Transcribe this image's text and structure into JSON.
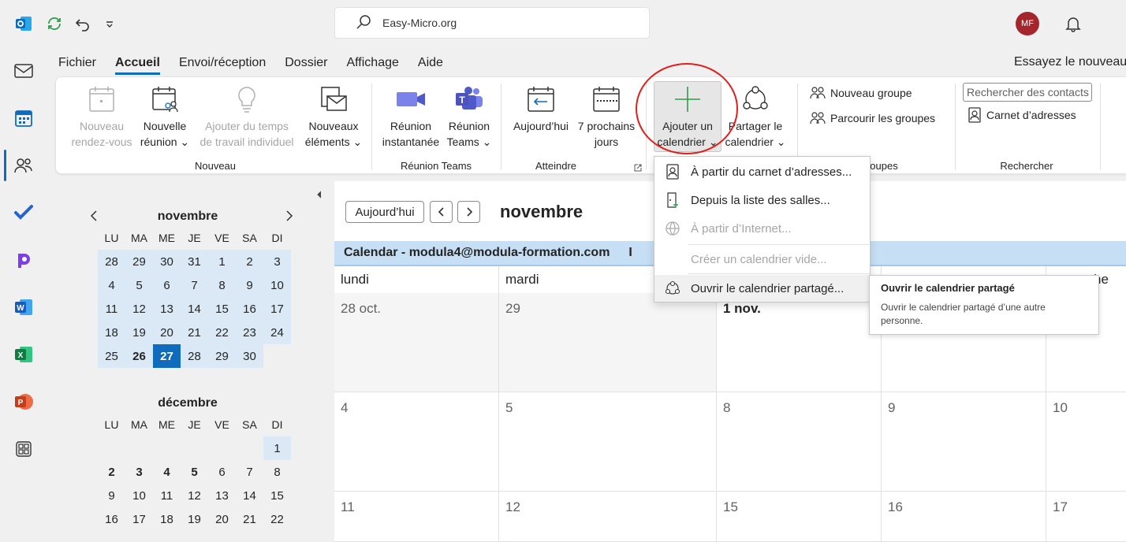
{
  "titlebar": {
    "search_text": "Easy-Micro.org",
    "avatar_initials": "MF"
  },
  "menu": {
    "items": [
      "Fichier",
      "Accueil",
      "Envoi/réception",
      "Dossier",
      "Affichage",
      "Aide"
    ],
    "selected": "Accueil",
    "try_new": "Essayez le nouveau"
  },
  "ribbon": {
    "nouveau_rdv": [
      "Nouveau",
      "rendez-vous"
    ],
    "nouvelle_reunion": [
      "Nouvelle",
      "réunion ⌄"
    ],
    "ajouter_temps": [
      "Ajouter du temps",
      "de travail individuel"
    ],
    "nouveaux_elements": [
      "Nouveaux",
      "éléments ⌄"
    ],
    "group_nouveau": "Nouveau",
    "reunion_instantanee": [
      "Réunion",
      "instantanée"
    ],
    "reunion_teams": [
      "Réunion",
      "Teams ⌄"
    ],
    "group_teams": "Réunion Teams",
    "aujourdhui": "Aujourd’hui",
    "sept_jours": [
      "7 prochains",
      "jours"
    ],
    "group_atteindre": "Atteindre",
    "ajouter_calendrier": [
      "Ajouter un",
      "calendrier ⌄"
    ],
    "partager": [
      "Partager le",
      "calendrier ⌄"
    ],
    "nouveau_groupe": "Nouveau groupe",
    "parcourir_groupes": "Parcourir les groupes",
    "group_groupes": "oupes",
    "rechercher_placeholder": "Rechercher des contacts",
    "carnet": "Carnet d’adresses",
    "group_rechercher": "Rechercher"
  },
  "mini_calendars": [
    {
      "title": "novembre",
      "dow": [
        "LU",
        "MA",
        "ME",
        "JE",
        "VE",
        "SA",
        "DI"
      ],
      "weeks": [
        [
          "28",
          "29",
          "30",
          "31",
          "1",
          "2",
          "3"
        ],
        [
          "4",
          "5",
          "6",
          "7",
          "8",
          "9",
          "10"
        ],
        [
          "11",
          "12",
          "13",
          "14",
          "15",
          "16",
          "17"
        ],
        [
          "18",
          "19",
          "20",
          "21",
          "22",
          "23",
          "24"
        ],
        [
          "25",
          "26",
          "27",
          "28",
          "29",
          "30",
          ""
        ]
      ]
    },
    {
      "title": "décembre",
      "dow": [
        "LU",
        "MA",
        "ME",
        "JE",
        "VE",
        "SA",
        "DI"
      ],
      "weeks": [
        [
          "",
          "",
          "",
          "",
          "",
          "",
          "1"
        ],
        [
          "2",
          "3",
          "4",
          "5",
          "6",
          "7",
          "8"
        ],
        [
          "9",
          "10",
          "11",
          "12",
          "13",
          "14",
          "15"
        ],
        [
          "16",
          "17",
          "18",
          "19",
          "20",
          "21",
          "22"
        ]
      ]
    }
  ],
  "calendar": {
    "today_button": "Aujourd’hui",
    "month": "novembre",
    "header_bar": "Calendar - modula4@modula-formation.com",
    "header_bar_extra": "I",
    "day_names": [
      "lundi",
      "mardi",
      "",
      "",
      "he"
    ],
    "rows": [
      [
        "28 oct.",
        "29",
        "1 nov.",
        "",
        ""
      ],
      [
        "4",
        "5",
        "8",
        "9",
        "10"
      ],
      [
        "11",
        "12",
        "15",
        "16",
        "17"
      ]
    ]
  },
  "dropdown": {
    "items": [
      "À partir du carnet d’adresses...",
      "Depuis la liste des salles...",
      "À partir d’Internet...",
      "Créer un calendrier vide...",
      "Ouvrir le calendrier partagé..."
    ]
  },
  "tooltip": {
    "title": "Ouvrir le calendrier partagé",
    "description": "Ouvrir le calendrier partagé d’une autre personne."
  },
  "colors": {
    "accent": "#0f6cbd",
    "highlight": "#dbe9f7",
    "calbar": "#c7dff4",
    "annotation": "#e0201d"
  }
}
